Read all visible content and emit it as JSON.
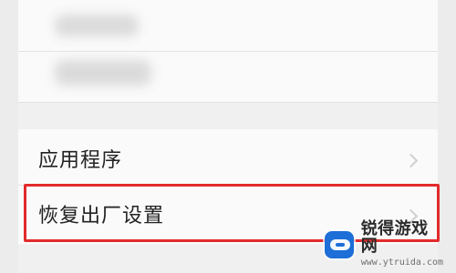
{
  "settings": {
    "items": [
      {
        "label": "应用程序"
      },
      {
        "label": "恢复出厂设置"
      }
    ]
  },
  "watermark": {
    "title": "锐得游戏网",
    "url": "www.ytruida.com"
  },
  "colors": {
    "highlight": "#e22b2b",
    "background": "#f0f0f0",
    "card": "#fafafa"
  }
}
